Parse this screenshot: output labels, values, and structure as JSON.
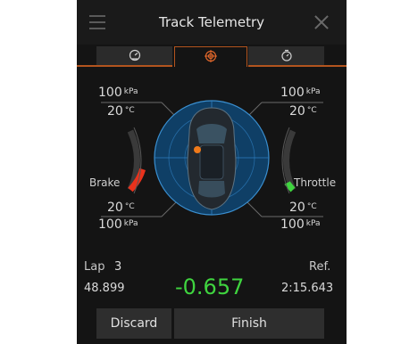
{
  "header": {
    "title": "Track Telemetry"
  },
  "tabs": [
    {
      "icon": "speedometer-icon"
    },
    {
      "icon": "target-icon",
      "active": true
    },
    {
      "icon": "stopwatch-icon"
    }
  ],
  "tires": {
    "front_left": {
      "pressure": "100",
      "pressure_unit": "kPa",
      "temp": "20",
      "temp_unit": "°C"
    },
    "front_right": {
      "pressure": "100",
      "pressure_unit": "kPa",
      "temp": "20",
      "temp_unit": "°C"
    },
    "rear_left": {
      "pressure": "100",
      "pressure_unit": "kPa",
      "temp": "20",
      "temp_unit": "°C"
    },
    "rear_right": {
      "pressure": "100",
      "pressure_unit": "kPa",
      "temp": "20",
      "temp_unit": "°C"
    }
  },
  "brake": {
    "label": "Brake",
    "level": 0.35,
    "color": "#e8321c"
  },
  "throttle": {
    "label": "Throttle",
    "level": 0.12,
    "color": "#3fd43f"
  },
  "lap": {
    "label": "Lap",
    "number": "3",
    "time": "48.899"
  },
  "delta": {
    "value": "-0.657",
    "color": "#3fd43f"
  },
  "reference": {
    "label": "Ref.",
    "time": "2:15.643"
  },
  "actions": {
    "discard": "Discard",
    "finish": "Finish"
  },
  "colors": {
    "accent": "#b3541e",
    "radar": "#1f6fae",
    "dot": "#f07a1a"
  }
}
